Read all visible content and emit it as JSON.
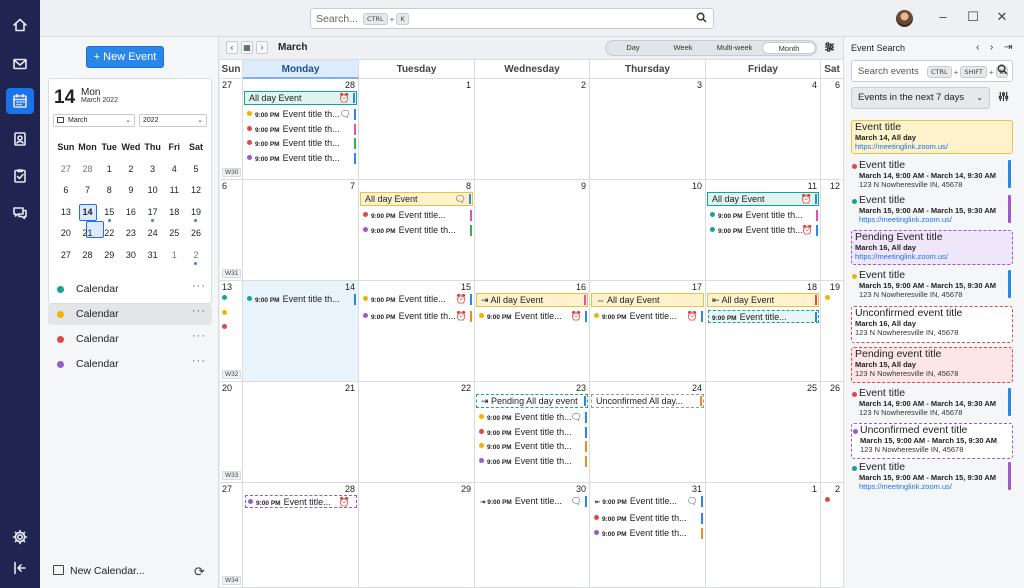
{
  "topbar": {
    "search_placeholder": "Search...",
    "search_keys": [
      "CTRL",
      "K"
    ]
  },
  "rail": {
    "items": [
      {
        "icon": "home-icon",
        "label": ""
      },
      {
        "icon": "mail-icon",
        "label": ""
      },
      {
        "icon": "calendar-icon",
        "label": "",
        "active": true
      },
      {
        "icon": "contacts-icon",
        "label": ""
      },
      {
        "icon": "tasks-icon",
        "label": ""
      },
      {
        "icon": "chat-icon",
        "label": ""
      }
    ],
    "bottom": [
      {
        "icon": "gear-icon"
      },
      {
        "icon": "collapse-icon"
      }
    ]
  },
  "sidebar": {
    "new_event_label": "+ New Event",
    "mini": {
      "day": "14",
      "weekday": "Mon",
      "month_year": "March 2022",
      "month_select": "March",
      "year_select": "2022",
      "headers": [
        "Sun",
        "Mon",
        "Tue",
        "Wed",
        "Thu",
        "Fri",
        "Sat"
      ],
      "weeks": [
        [
          {
            "d": "27",
            "dim": true
          },
          {
            "d": "28",
            "dim": true
          },
          {
            "d": "1"
          },
          {
            "d": "2"
          },
          {
            "d": "3"
          },
          {
            "d": "4"
          },
          {
            "d": "5"
          }
        ],
        [
          {
            "d": "6"
          },
          {
            "d": "7"
          },
          {
            "d": "8"
          },
          {
            "d": "9"
          },
          {
            "d": "10"
          },
          {
            "d": "11"
          },
          {
            "d": "12"
          }
        ],
        [
          {
            "d": "13"
          },
          {
            "d": "14",
            "today": true,
            "dot": true
          },
          {
            "d": "15",
            "dot": true
          },
          {
            "d": "16"
          },
          {
            "d": "17",
            "dot": true
          },
          {
            "d": "18"
          },
          {
            "d": "19",
            "dot": true
          }
        ],
        [
          {
            "d": "20"
          },
          {
            "d": "21"
          },
          {
            "d": "22"
          },
          {
            "d": "23"
          },
          {
            "d": "24"
          },
          {
            "d": "25"
          },
          {
            "d": "26"
          }
        ],
        [
          {
            "d": "27"
          },
          {
            "d": "28"
          },
          {
            "d": "29"
          },
          {
            "d": "30"
          },
          {
            "d": "31"
          },
          {
            "d": "1",
            "dim": true
          },
          {
            "d": "2",
            "dim": true,
            "dot": true
          }
        ]
      ]
    },
    "calendars": [
      {
        "label": "Calendar",
        "color": "#14a39a",
        "selected": false
      },
      {
        "label": "Calendar",
        "color": "#f0b400",
        "selected": true
      },
      {
        "label": "Calendar",
        "color": "#e04848",
        "selected": false
      },
      {
        "label": "Calendar",
        "color": "#9b59d0",
        "selected": false
      }
    ],
    "more_label": "···",
    "new_calendar_label": "New Calendar...",
    "refresh_glyph": "⟳"
  },
  "main": {
    "month_label": "March",
    "views": [
      {
        "label": "Day",
        "active": false
      },
      {
        "label": "Week",
        "active": false
      },
      {
        "label": "Multi-week",
        "active": false
      },
      {
        "label": "Month",
        "active": true
      }
    ],
    "dow": [
      "Sun",
      "Monday",
      "Tuesday",
      "Wednesday",
      "Thursday",
      "Friday",
      "Sat"
    ],
    "weeks": [
      {
        "wk": "W30",
        "days": [
          "27",
          "28",
          "1",
          "2",
          "3",
          "4",
          "6"
        ]
      },
      {
        "wk": "W31",
        "days": [
          "6",
          "7",
          "8",
          "9",
          "10",
          "11",
          "12"
        ]
      },
      {
        "wk": "W32",
        "days": [
          "13",
          "14",
          "15",
          "16",
          "17",
          "18",
          "19"
        ]
      },
      {
        "wk": "W33",
        "days": [
          "20",
          "21",
          "22",
          "23",
          "24",
          "25",
          "26"
        ]
      },
      {
        "wk": "W34",
        "days": [
          "27",
          "28",
          "29",
          "30",
          "31",
          "1",
          "2"
        ]
      }
    ],
    "colors": {
      "teal": "#14a39a",
      "yellow": "#f0b400",
      "red": "#e04848",
      "purple": "#9b59d0",
      "blue": "#2a86e8",
      "orange": "#f08a24",
      "pink": "#e052b0",
      "green": "#2fb35a"
    },
    "allday_events": [
      {
        "week": 0,
        "col": 1,
        "span": 1,
        "label": "All day Event",
        "style": "teal",
        "icon": "⏰",
        "bar": "#2a86e8"
      },
      {
        "week": 1,
        "col": 2,
        "span": 1,
        "label": "All day Event",
        "style": "yellow",
        "icon": "🗨",
        "bar": "#2a86e8"
      },
      {
        "week": 1,
        "col": 5,
        "span": 1,
        "label": "All day Event",
        "style": "teal",
        "icon": "⏰",
        "bar": "#2a86e8"
      },
      {
        "week": 2,
        "col": 3,
        "span": 1,
        "label": "⇥ All day Event",
        "style": "yellow",
        "icon": "",
        "bar": "#e052b0"
      },
      {
        "week": 2,
        "col": 4,
        "span": 1,
        "label": "⇔ All day Event",
        "style": "yellow",
        "icon": "",
        "bar": ""
      },
      {
        "week": 2,
        "col": 5,
        "span": 1,
        "label": "⇤ All day Event",
        "style": "yellow",
        "icon": "",
        "bar": "#e04848"
      },
      {
        "week": 3,
        "col": 3,
        "span": 1,
        "label": "⇥ Pending All day event",
        "style": "pending-teal",
        "icon": "",
        "bar": "#2a86e8"
      },
      {
        "week": 3,
        "col": 4,
        "span": 1,
        "label": "Unconfirmed All day...",
        "style": "unconfirmed",
        "icon": "",
        "bar": "#f08a24"
      }
    ],
    "timed_events": [
      {
        "week": 0,
        "col": 1,
        "row": 0,
        "dot": "yellow",
        "time": "9:00 PM",
        "label": "Event title th...",
        "icon": "🗨",
        "bar": "#2a86e8"
      },
      {
        "week": 0,
        "col": 1,
        "row": 1,
        "dot": "red",
        "time": "9:00 PM",
        "label": "Event title th...",
        "icon": "",
        "bar": "#e052b0"
      },
      {
        "week": 0,
        "col": 1,
        "row": 2,
        "dot": "red",
        "time": "9:00 PM",
        "label": "Event title th...",
        "icon": "",
        "bar": "#2fb35a"
      },
      {
        "week": 0,
        "col": 1,
        "row": 3,
        "dot": "purple",
        "time": "9:00 PM",
        "label": "Event title th...",
        "icon": "",
        "bar": "#2a86e8"
      },
      {
        "week": 1,
        "col": 2,
        "row": 0,
        "dot": "red",
        "time": "9:00 PM",
        "label": "Event title...",
        "icon": "",
        "bar": "#e052b0"
      },
      {
        "week": 1,
        "col": 2,
        "row": 1,
        "dot": "purple",
        "time": "9:00 PM",
        "label": "Event title th...",
        "icon": "",
        "bar": "#2fb35a"
      },
      {
        "week": 1,
        "col": 5,
        "row": 0,
        "dot": "teal",
        "time": "9:00 PM",
        "label": "Event title th...",
        "icon": "",
        "bar": "#e052b0"
      },
      {
        "week": 1,
        "col": 5,
        "row": 1,
        "dot": "teal",
        "time": "9:00 PM",
        "label": "Event title th...",
        "icon": "⏰",
        "bar": "#2a86e8"
      },
      {
        "week": 2,
        "col": 1,
        "row": -1,
        "dot": "teal",
        "time": "9:00 PM",
        "label": "Event title th...",
        "icon": "",
        "bar": "#2a86e8"
      },
      {
        "week": 2,
        "col": 2,
        "row": -1,
        "dot": "yellow",
        "time": "9:00 PM",
        "label": "Event title...",
        "icon": "⏰",
        "bar": "#2a86e8"
      },
      {
        "week": 2,
        "col": 2,
        "row": 0,
        "dot": "purple",
        "time": "9:00 PM",
        "label": "Event title th...",
        "icon": "⏰",
        "bar": "#f08a24"
      },
      {
        "week": 2,
        "col": 3,
        "row": 0,
        "dot": "yellow",
        "time": "9:00 PM",
        "label": "Event title...",
        "icon": "⏰",
        "bar": "#2a86e8"
      },
      {
        "week": 2,
        "col": 4,
        "row": 0,
        "dot": "yellow",
        "time": "9:00 PM",
        "label": "Event title...",
        "icon": "⏰",
        "bar": "#2a86e8"
      },
      {
        "week": 2,
        "col": 5,
        "row": 0,
        "dot": "",
        "time": "9:00 PM",
        "label": "Event title...",
        "icon": "",
        "bar": "#2a86e8",
        "pending": true
      },
      {
        "week": 3,
        "col": 3,
        "row": 0,
        "dot": "yellow",
        "time": "9:00 PM",
        "label": "Event title th...",
        "icon": "🗨",
        "bar": "#2a86e8"
      },
      {
        "week": 3,
        "col": 3,
        "row": 1,
        "dot": "red",
        "time": "9:00 PM",
        "label": "Event title th...",
        "icon": "",
        "bar": "#2a86e8"
      },
      {
        "week": 3,
        "col": 3,
        "row": 2,
        "dot": "yellow",
        "time": "9:00 PM",
        "label": "Event title th...",
        "icon": "",
        "bar": "#f08a24"
      },
      {
        "week": 3,
        "col": 3,
        "row": 3,
        "dot": "purple",
        "time": "9:00 PM",
        "label": "Event title th...",
        "icon": "",
        "bar": "#f08a24"
      },
      {
        "week": 4,
        "col": 1,
        "row": -1,
        "dot": "purple",
        "time": "9:00 PM",
        "label": "Event title...",
        "icon": "⏰",
        "bar": "",
        "pending": true
      },
      {
        "week": 4,
        "col": 3,
        "row": -1,
        "dot": "",
        "time": "⇥ 9:00 PM",
        "label": "Event title...",
        "icon": "🗨",
        "bar": "#2a86e8"
      },
      {
        "week": 4,
        "col": 4,
        "row": -1,
        "dot": "",
        "time": "⇤ 9:00 PM",
        "label": "Event title...",
        "icon": "🗨",
        "bar": "#2a86e8"
      },
      {
        "week": 4,
        "col": 4,
        "row": 0,
        "dot": "red",
        "time": "9:00 PM",
        "label": "Event title th...",
        "icon": "",
        "bar": "#2a86e8"
      },
      {
        "week": 4,
        "col": 4,
        "row": 1,
        "dot": "purple",
        "time": "9:00 PM",
        "label": "Event title th...",
        "icon": "",
        "bar": "#f08a24"
      }
    ],
    "side_dots": [
      {
        "week": 2,
        "col": 0,
        "colors": [
          "teal",
          "yellow",
          "red"
        ]
      },
      {
        "week": 2,
        "col": 6,
        "colors": [
          "yellow"
        ]
      },
      {
        "week": 4,
        "col": 6,
        "colors": [
          "red"
        ]
      }
    ]
  },
  "rpanel": {
    "title": "Event Search",
    "search_placeholder": "Search events",
    "search_keys": [
      "CTRL",
      "SHIFT",
      "K"
    ],
    "range_label": "Events in the next 7 days",
    "results": [
      {
        "title": "Event title",
        "sub": "March 14, All day",
        "link": "https://meetinglink.zoom.us/",
        "style": "allday-yellow",
        "dot": "",
        "bar": ""
      },
      {
        "title": "Event title",
        "sub": "March 14, 9:00 AM - March 14, 9:30 AM",
        "addr": "123 N Nowheresville IN, 45678",
        "style": "plain",
        "dot": "#e04848",
        "bar": "#2a86e8"
      },
      {
        "title": "Event title",
        "sub": "March 15, 9:00 AM - March 15, 9:30 AM",
        "link": "https://meetinglink.zoom.us/",
        "style": "plain",
        "dot": "#14a39a",
        "bar": "#9b59d0"
      },
      {
        "title": "Pending Event title",
        "sub": "March 16, All day",
        "link": "https://meetinglink.zoom.us/",
        "style": "pending-purple",
        "dot": "",
        "bar": ""
      },
      {
        "title": "Event title",
        "sub": "March 15, 9:00 AM - March 15, 9:30 AM",
        "addr": "123 N Nowheresville IN, 45678",
        "style": "plain",
        "dot": "#f0b400",
        "bar": "#2a86e8"
      },
      {
        "title": "Unconfirmed event title",
        "sub": "March 16, All day",
        "addr": "123 N Nowheresville IN, 45678",
        "style": "unconfirmed",
        "dot": "",
        "bar": ""
      },
      {
        "title": "Pending event title",
        "sub": "March 15, All day",
        "addr": "123 N Nowheresville IN, 45678",
        "style": "pending-red",
        "dot": "",
        "bar": ""
      },
      {
        "title": "Event title",
        "sub": "March 14, 9:00 AM - March 14, 9:30 AM",
        "addr": "123 N Nowheresville IN, 45678",
        "style": "plain",
        "dot": "#e04848",
        "bar": "#2a86e8"
      },
      {
        "title": "Unconfirmed event title",
        "sub": "March 15, 9:00 AM - March 15, 9:30 AM",
        "addr": "123 N Nowheresville IN, 45678",
        "style": "unconfirmed-purple",
        "dot": "#9b59d0",
        "bar": ""
      },
      {
        "title": "Event title",
        "sub": "March 15, 9:00 AM - March 15, 9:30 AM",
        "link": "https://meetinglink.zoom.us/",
        "style": "plain",
        "dot": "#14a39a",
        "bar": "#9b59d0"
      }
    ]
  }
}
